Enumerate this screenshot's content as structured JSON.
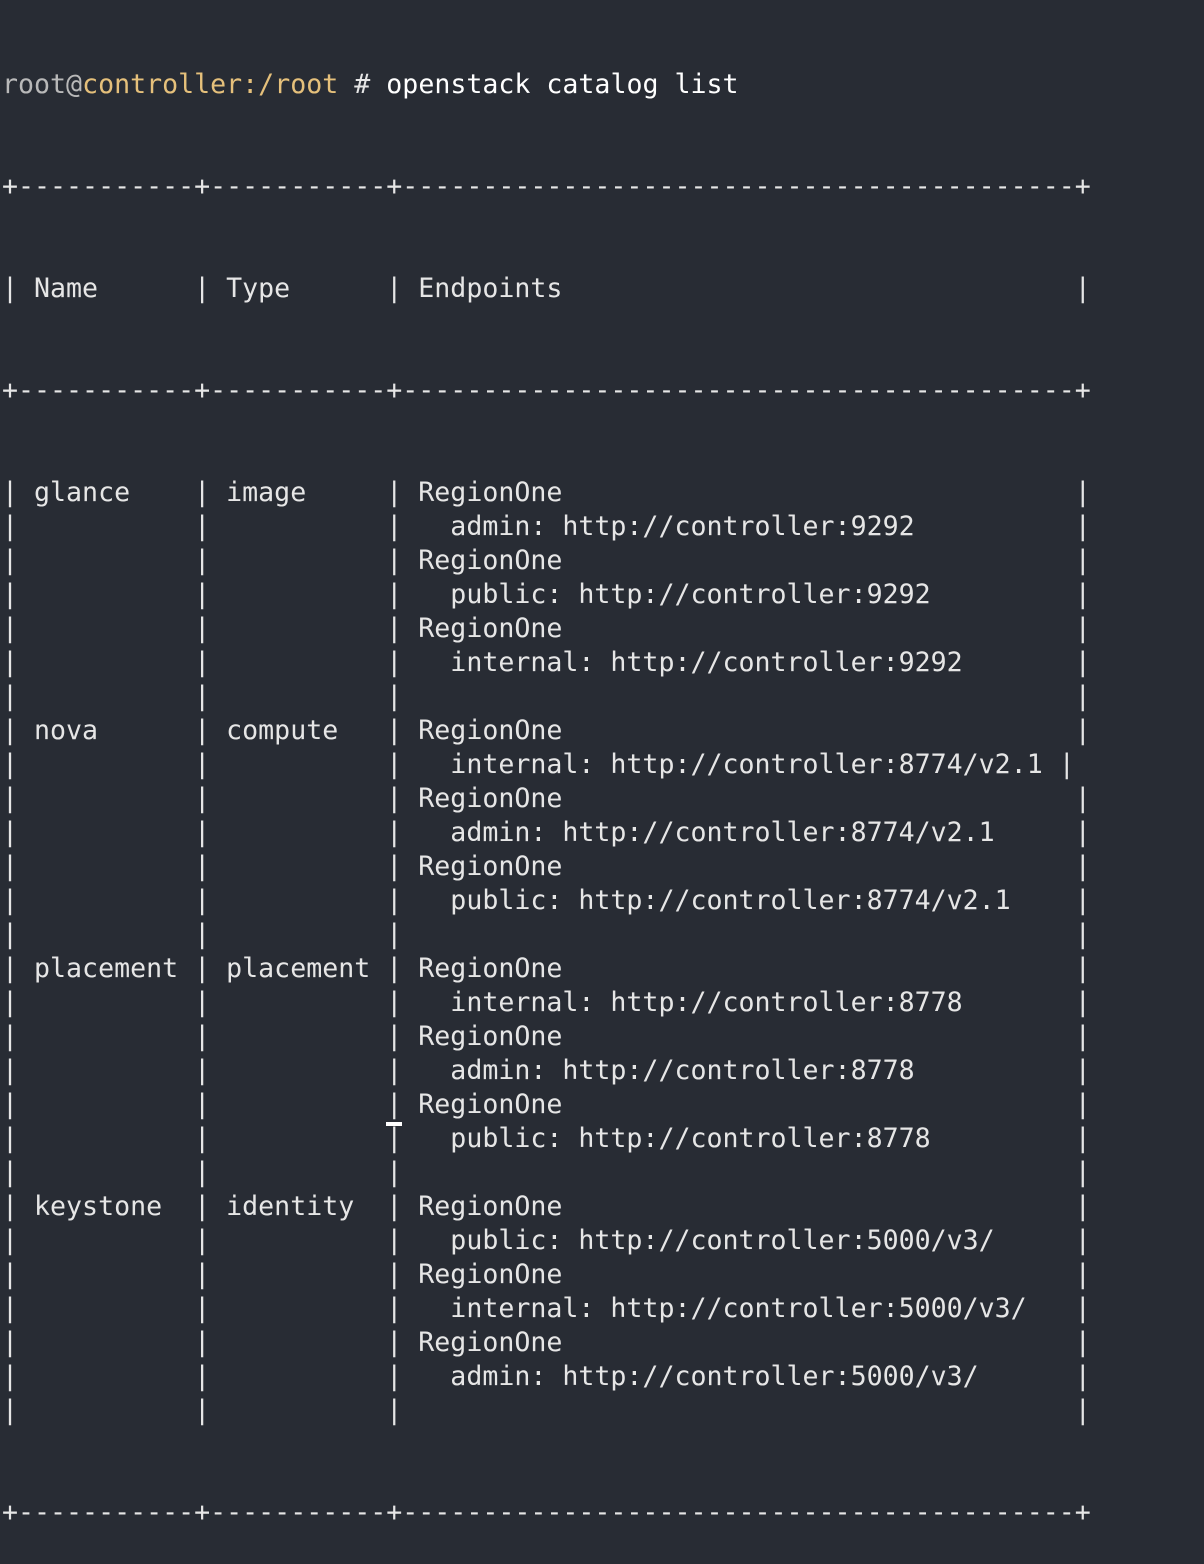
{
  "prompt": {
    "user": "root",
    "at": "@",
    "host": "controller",
    "path": ":/root",
    "symbol": " # ",
    "command": "openstack catalog list"
  },
  "table": {
    "border_top": "+-----------+-----------+------------------------------------------+",
    "border_sep": "+-----------+-----------+------------------------------------------+",
    "border_bottom": "+-----------+-----------+------------------------------------------+",
    "header": "| Name      | Type      | Endpoints                                |",
    "rows": [
      "| glance    | image     | RegionOne                                |",
      "|           |           |   admin: http://controller:9292          |",
      "|           |           | RegionOne                                |",
      "|           |           |   public: http://controller:9292         |",
      "|           |           | RegionOne                                |",
      "|           |           |   internal: http://controller:9292       |",
      "|           |           |                                          |",
      "| nova      | compute   | RegionOne                                |",
      "|           |           |   internal: http://controller:8774/v2.1 |",
      "|           |           | RegionOne                                |",
      "|           |           |   admin: http://controller:8774/v2.1     |",
      "|           |           | RegionOne                                |",
      "|           |           |   public: http://controller:8774/v2.1    |",
      "|           |           |                                          |",
      "| placement | placement | RegionOne                                |",
      "|           |           |   internal: http://controller:8778       |",
      "|           |           | RegionOne                                |",
      "|           |           |   admin: http://controller:8778          |",
      "|           |           | RegionOne                                |",
      "|           |           |   public: http://controller:8778         |",
      "|           |           |                                          |",
      "| keystone  | identity  | RegionOne                                |",
      "|           |           |   public: http://controller:5000/v3/     |",
      "|           |           | RegionOne                                |",
      "|           |           |   internal: http://controller:5000/v3/   |",
      "|           |           | RegionOne                                |",
      "|           |           |   admin: http://controller:5000/v3/      |",
      "|           |           |                                          |"
    ]
  },
  "colors": {
    "background": "#282c34",
    "text": "#e6e6e6",
    "host": "#e5c07b"
  }
}
